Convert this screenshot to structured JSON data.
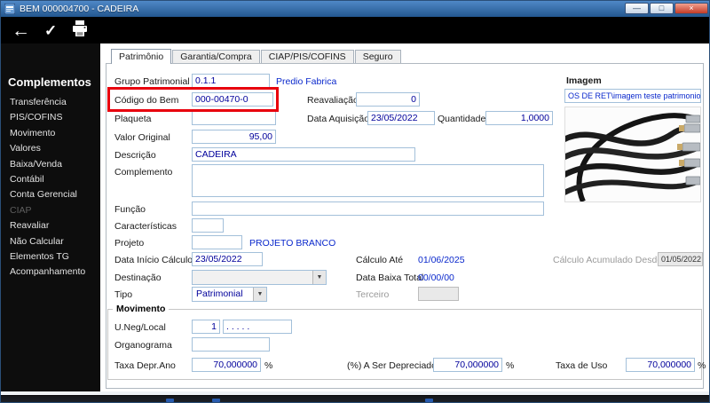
{
  "window": {
    "title": "BEM 000004700 - CADEIRA",
    "minimize": "—",
    "maximize": "□",
    "close": "×"
  },
  "toolbar": {
    "back": "←",
    "confirm": "✓",
    "print": "printer"
  },
  "sidebar": {
    "heading": "Complementos",
    "items": [
      {
        "label": "Transferência"
      },
      {
        "label": "PIS/COFINS"
      },
      {
        "label": "Movimento"
      },
      {
        "label": "Valores"
      },
      {
        "label": "Baixa/Venda"
      },
      {
        "label": "Contábil"
      },
      {
        "label": "Conta Gerencial"
      },
      {
        "label": "CIAP",
        "disabled": true
      },
      {
        "label": "Reavaliar"
      },
      {
        "label": "Não Calcular"
      },
      {
        "label": "Elementos TG"
      },
      {
        "label": "Acompanhamento"
      }
    ]
  },
  "tabs": [
    {
      "label": "Patrimônio",
      "active": true
    },
    {
      "label": "Garantia/Compra"
    },
    {
      "label": "CIAP/PIS/COFINS"
    },
    {
      "label": "Seguro"
    }
  ],
  "form": {
    "grupo": {
      "label": "Grupo Patrimonial",
      "value": "0.1.1",
      "desc": "Predio Fabrica"
    },
    "codigo": {
      "label": "Código do Bem",
      "value": "000-00470-0"
    },
    "reavaliacao": {
      "label": "Reavaliação",
      "value": "0"
    },
    "plaqueta": {
      "label": "Plaqueta",
      "value": ""
    },
    "aquisicao": {
      "label": "Data Aquisição",
      "value": "23/05/2022"
    },
    "quantidade": {
      "label": "Quantidade",
      "value": "1,0000"
    },
    "valor": {
      "label": "Valor Original",
      "value": "95,00"
    },
    "descricao": {
      "label": "Descrição",
      "value": "CADEIRA"
    },
    "complemento": {
      "label": "Complemento",
      "value": ""
    },
    "funcao": {
      "label": "Função",
      "value": ""
    },
    "caracteristicas": {
      "label": "Características",
      "value": ""
    },
    "projeto": {
      "label": "Projeto",
      "value": "",
      "desc": "PROJETO BRANCO"
    },
    "inicio_calculo": {
      "label": "Data Início Cálculo",
      "value": "23/05/2022"
    },
    "calculo_ate": {
      "label": "Cálculo Até",
      "value": "01/06/2025"
    },
    "acumulado": {
      "label": "Cálculo Acumulado Desde",
      "value": "01/05/2022"
    },
    "destinacao": {
      "label": "Destinação",
      "value": ""
    },
    "baixa_total": {
      "label": "Data Baixa Total",
      "value": "00/00/00"
    },
    "tipo": {
      "label": "Tipo",
      "value": "Patrimonial"
    },
    "terceiro": {
      "label": "Terceiro",
      "value": ""
    }
  },
  "imagem": {
    "heading": "Imagem",
    "path": "OS DE RET\\imagem teste patrimonio.jpg"
  },
  "movimento": {
    "heading": "Movimento",
    "uneg": {
      "label": "U.Neg/Local",
      "value1": "1",
      "value2": ". . . . ."
    },
    "organograma": {
      "label": "Organograma",
      "value": ""
    },
    "taxa_depr": {
      "label": "Taxa Depr.Ano",
      "value": "70,000000",
      "unit": "%"
    },
    "a_depreciar": {
      "label": "(%) A Ser Depreciado",
      "value": "70,000000",
      "unit": "%"
    },
    "taxa_uso": {
      "label": "Taxa de Uso",
      "value": "70,000000",
      "unit": "%"
    }
  },
  "colors": {
    "titlebar": "#2f6db5",
    "field_text": "#00009b",
    "link_text": "#0a28cc",
    "annotation": "#e8000d",
    "sidebar_bg": "#0d0d0d"
  }
}
